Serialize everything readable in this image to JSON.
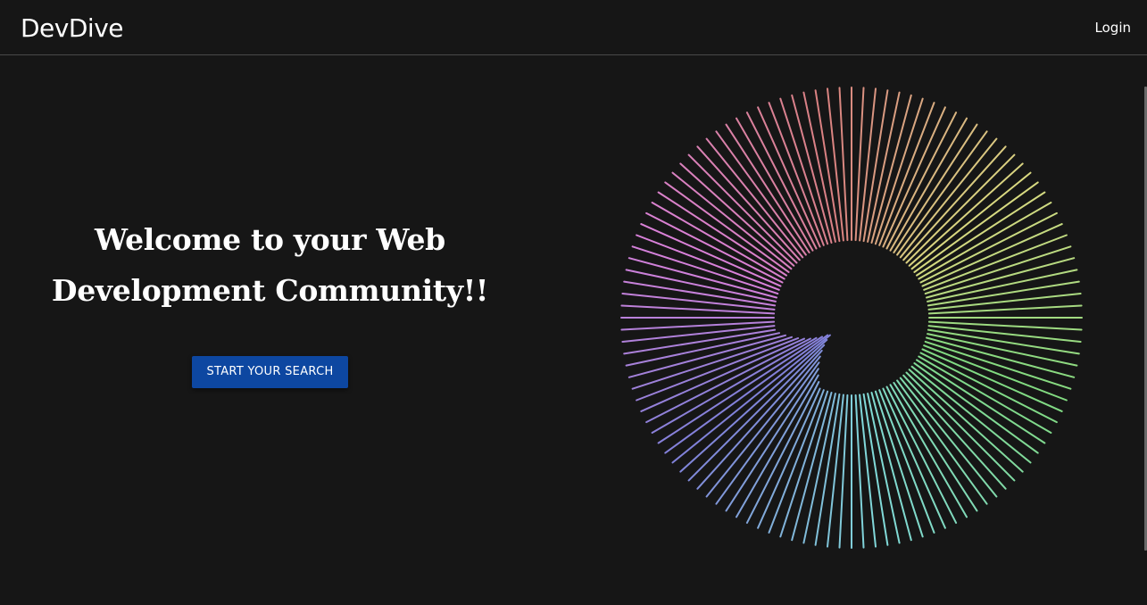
{
  "navbar": {
    "brand": "DevDive",
    "login_label": "Login"
  },
  "hero": {
    "title_line1": "Welcome to your Web",
    "title_line2": "Development Community!!",
    "cta_label": "START YOUR SEARCH"
  },
  "theme": {
    "background": "#161616",
    "cta_color": "#0d47a1",
    "text_color": "#ffffff"
  }
}
